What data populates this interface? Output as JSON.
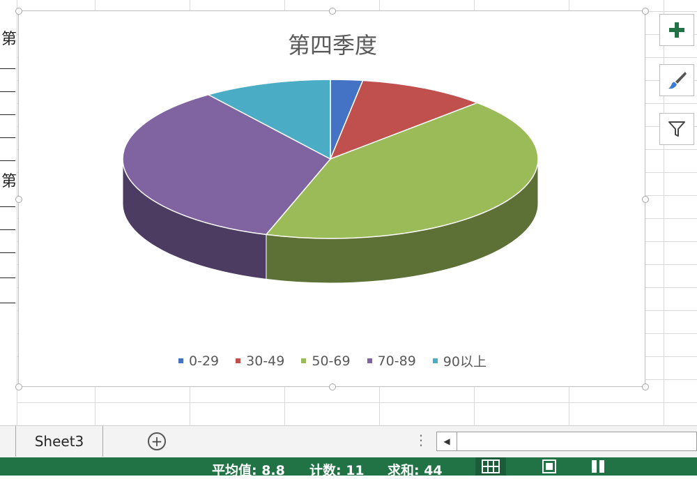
{
  "chart": {
    "title": "第四季度",
    "legend": [
      {
        "label": "0-29",
        "color": "#4472C4"
      },
      {
        "label": "30-49",
        "color": "#C0504D"
      },
      {
        "label": "50-69",
        "color": "#9BBB59"
      },
      {
        "label": "70-89",
        "color": "#8064A2"
      },
      {
        "label": "90以上",
        "color": "#4BACC6"
      }
    ]
  },
  "chart_data": {
    "type": "pie",
    "title": "第四季度",
    "categories": [
      "0-29",
      "30-49",
      "50-69",
      "70-89",
      "90以上"
    ],
    "values": [
      1,
      4,
      17,
      14,
      4
    ],
    "colors": [
      "#4472C4",
      "#C0504D",
      "#9BBB59",
      "#8064A2",
      "#4BACC6"
    ],
    "style": "3d-pie",
    "legend": "bottom"
  },
  "left_labels": [
    "第",
    "第"
  ],
  "side_buttons": [
    {
      "icon": "plus-icon",
      "label": "chart-elements"
    },
    {
      "icon": "brush-icon",
      "label": "chart-styles"
    },
    {
      "icon": "filter-icon",
      "label": "chart-filters"
    }
  ],
  "tabs": {
    "sheet": "Sheet3",
    "add": "+",
    "more": "⋮",
    "scroll_left": "◀"
  },
  "status": {
    "average": "平均值: 8.8",
    "count": "计数: 11",
    "sum": "求和: 44"
  },
  "colors": {
    "status_bar": "#217346",
    "accent_plus": "#217346"
  }
}
